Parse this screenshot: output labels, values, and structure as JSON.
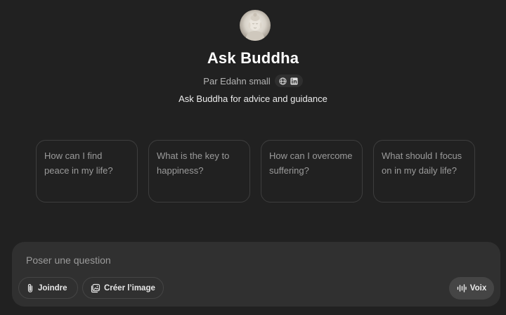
{
  "gpt": {
    "name": "Ask Buddha",
    "author": "Par Edahn small",
    "description": "Ask Buddha for advice and guidance",
    "social_icons": [
      "globe-icon",
      "linkedin-icon"
    ]
  },
  "suggestions": [
    {
      "text": "How can I find peace in my life?"
    },
    {
      "text": "What is the key to happiness?"
    },
    {
      "text": "How can I overcome suffering?"
    },
    {
      "text": "What should I focus on in my daily life?"
    }
  ],
  "composer": {
    "placeholder": "Poser une question",
    "attach_label": "Joindre",
    "attach_icon": "paperclip-icon",
    "image_label": "Créer l’image",
    "image_icon": "image-create-icon",
    "voice_label": "Voix",
    "voice_icon": "waveform-icon"
  },
  "colors": {
    "background": "#212121",
    "composer": "#303030",
    "card_border": "#3e3e3e",
    "voice_button": "#454545"
  }
}
